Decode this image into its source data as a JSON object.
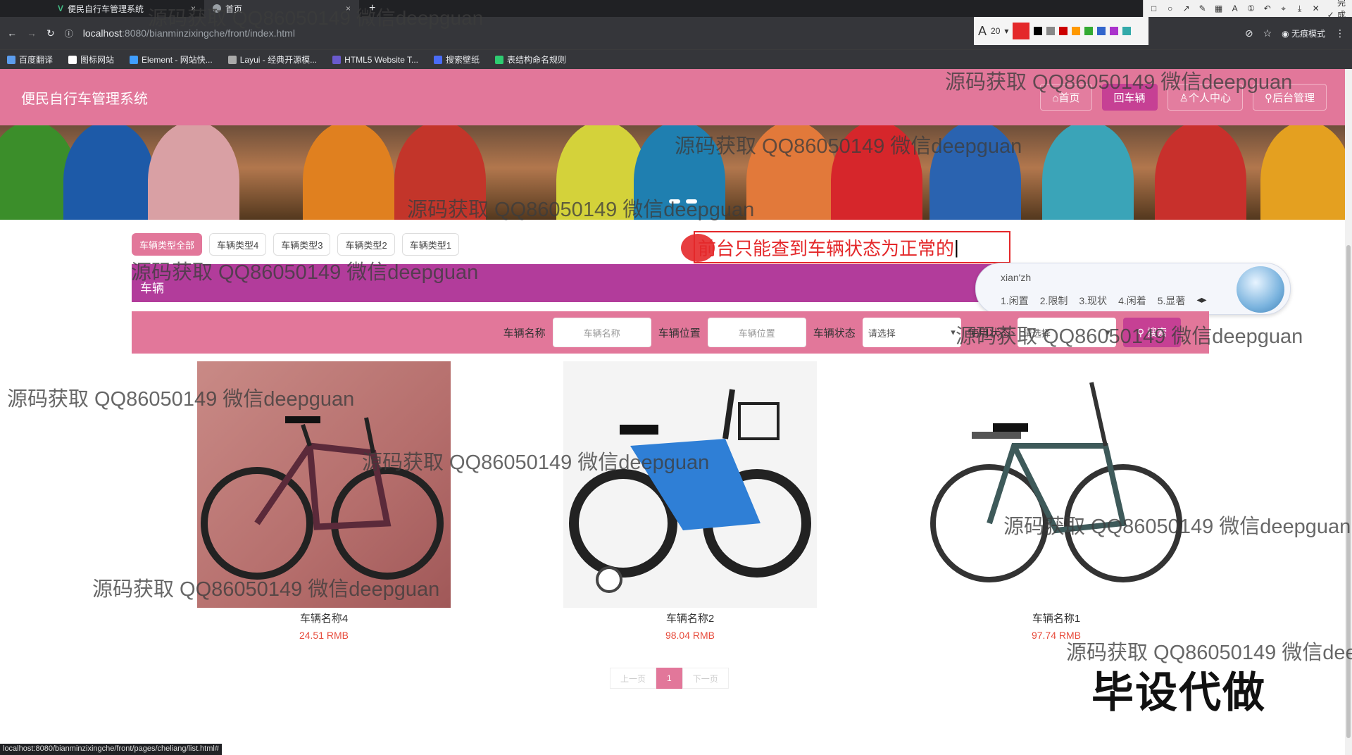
{
  "browser": {
    "tabs": [
      {
        "title": "便民自行车管理系统"
      },
      {
        "title": "首页"
      }
    ],
    "new_tab": "+",
    "url_host": "localhost",
    "url_rest": ":8080/bianminzixingche/front/index.html",
    "incognito_label": "无痕模式",
    "finish_label": "完成",
    "font_size": "20",
    "bookmarks": [
      "百度翻译",
      "图标网站",
      "Element - 网站快...",
      "Layui - 经典开源模...",
      "HTML5 Website T...",
      "搜索壁纸",
      "表结构命名规则"
    ],
    "status_url": "localhost:8080/bianminzixingche/front/pages/cheliang/list.html#"
  },
  "header": {
    "site_title": "便民自行车管理系统",
    "nav": [
      {
        "label": "⌂首页",
        "active": false
      },
      {
        "label": "回车辆",
        "active": true
      },
      {
        "label": "♙个人中心",
        "active": false
      },
      {
        "label": "⚲后台管理",
        "active": false
      }
    ]
  },
  "filter_chips": [
    "车辆类型全部",
    "车辆类型4",
    "车辆类型3",
    "车辆类型2",
    "车辆类型1"
  ],
  "annotation": "前台只能查到车辆状态为正常的",
  "ime": {
    "pinyin": "xian'zh",
    "candidates": [
      "1.闲置",
      "2.限制",
      "3.现状",
      "4.闲着",
      "5.显著"
    ]
  },
  "section_title": "车辆",
  "search": {
    "name_label": "车辆名称",
    "name_placeholder": "车辆名称",
    "location_label": "车辆位置",
    "location_placeholder": "车辆位置",
    "status_label": "车辆状态",
    "status_value": "请选择",
    "usage_label": "使用状态",
    "usage_value": "请选择",
    "button": "搜索"
  },
  "cards": [
    {
      "name": "车辆名称4",
      "price": "24.51 RMB"
    },
    {
      "name": "车辆名称2",
      "price": "98.04 RMB"
    },
    {
      "name": "车辆名称1",
      "price": "97.74 RMB"
    }
  ],
  "pagination": {
    "prev": "上一页",
    "current": "1",
    "next": "下一页"
  },
  "watermark": "源码获取 QQ86050149 微信deepguan",
  "promo": "毕设代做"
}
